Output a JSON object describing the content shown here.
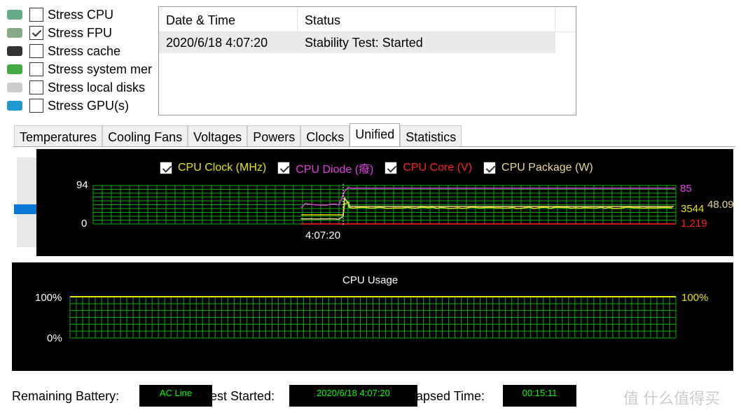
{
  "options": [
    {
      "label": "Stress CPU",
      "checked": false,
      "icon": "cpu-icon"
    },
    {
      "label": "Stress FPU",
      "checked": true,
      "icon": "fpu-icon"
    },
    {
      "label": "Stress cache",
      "checked": false,
      "icon": "cache-chip-icon"
    },
    {
      "label": "Stress system mer",
      "checked": false,
      "icon": "memory-icon"
    },
    {
      "label": "Stress local disks",
      "checked": false,
      "icon": "disk-icon"
    },
    {
      "label": "Stress GPU(s)",
      "checked": false,
      "icon": "gpu-monitor-icon"
    }
  ],
  "log": {
    "columns": [
      "Date & Time",
      "Status"
    ],
    "rows": [
      {
        "time": "2020/6/18 4:07:20",
        "status": "Stability Test: Started"
      }
    ]
  },
  "tabs": [
    "Temperatures",
    "Cooling Fans",
    "Voltages",
    "Powers",
    "Clocks",
    "Unified",
    "Statistics"
  ],
  "active_tab": "Unified",
  "chart_data": [
    {
      "type": "line",
      "legend": [
        {
          "name": "CPU Clock (MHz)",
          "color": "#e6e600",
          "checked": true,
          "current": "3544"
        },
        {
          "name": "CPU Diode (癈)",
          "color": "#e040e0",
          "checked": true,
          "current": "85"
        },
        {
          "name": "CPU Core (V)",
          "color": "#ff2020",
          "checked": true,
          "current": "1.219"
        },
        {
          "name": "CPU Package (W)",
          "color": "#e8d890",
          "checked": true,
          "current": "48.09"
        }
      ],
      "y_ticks": [
        "94",
        "0"
      ],
      "x_ticks": [
        "4:07:20"
      ],
      "grid": true,
      "grid_color": "#00b000"
    },
    {
      "type": "line",
      "title": "CPU Usage",
      "y_ticks": [
        "100%",
        "0%"
      ],
      "current": "100%",
      "color": "#e6e600",
      "grid": true
    }
  ],
  "status": {
    "battery_label": "Remaining Battery:",
    "battery": "AC Line",
    "started_label": "est Started:",
    "started": "2020/6/18 4:07:20",
    "elapsed_label": "apsed Time:",
    "elapsed": "00:15:11"
  },
  "watermark": "值 什么值得买"
}
